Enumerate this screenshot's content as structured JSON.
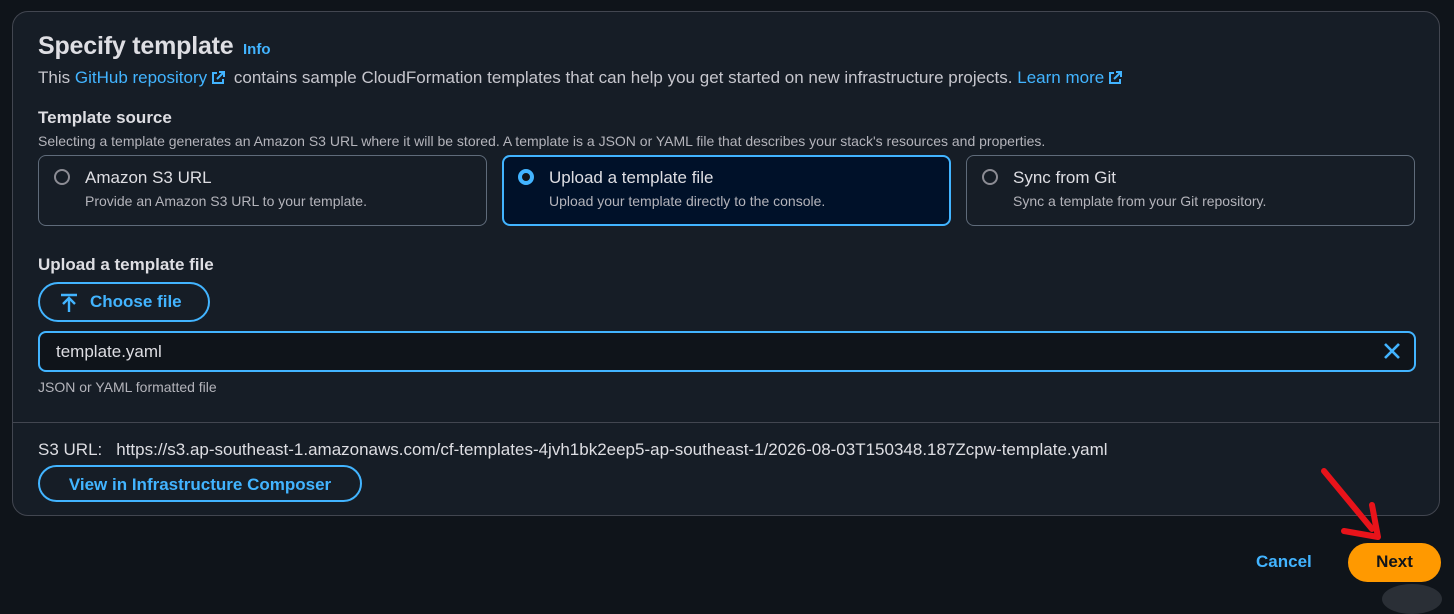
{
  "header": {
    "title": "Specify template",
    "info": "Info",
    "desc_prefix": "This",
    "github_link": "GitHub repository",
    "desc_middle": "contains sample CloudFormation templates that can help you get started on new infrastructure projects.",
    "learn_more": "Learn more"
  },
  "template_source": {
    "label": "Template source",
    "description": "Selecting a template generates an Amazon S3 URL where it will be stored. A template is a JSON or YAML file that describes your stack's resources and properties.",
    "options": [
      {
        "title": "Amazon S3 URL",
        "desc": "Provide an Amazon S3 URL to your template.",
        "selected": false
      },
      {
        "title": "Upload a template file",
        "desc": "Upload your template directly to the console.",
        "selected": true
      },
      {
        "title": "Sync from Git",
        "desc": "Sync a template from your Git repository.",
        "selected": false
      }
    ]
  },
  "upload": {
    "label": "Upload a template file",
    "choose_file": "Choose file",
    "file_name": "template.yaml",
    "hint": "JSON or YAML formatted file"
  },
  "s3": {
    "label": "S3 URL:",
    "url": "https://s3.ap-southeast-1.amazonaws.com/cf-templates-4jvh1bk2eep5-ap-southeast-1/2026-08-03T150348.187Zcpw-template.yaml",
    "composer_button": "View in Infrastructure Composer"
  },
  "footer": {
    "cancel": "Cancel",
    "next": "Next"
  },
  "colors": {
    "accent": "#42b4ff",
    "primary_button": "#ff9900",
    "annotation_arrow": "#e8131a"
  }
}
